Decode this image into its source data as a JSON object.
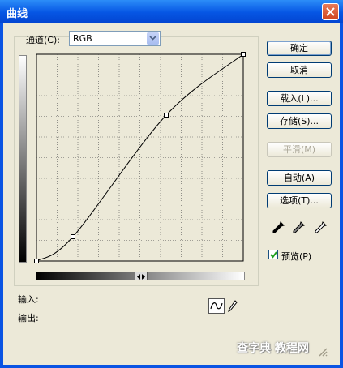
{
  "window": {
    "title": "曲线"
  },
  "channel": {
    "label": "通道(C):",
    "value": "RGB"
  },
  "io": {
    "input_label": "输入:",
    "output_label": "输出:"
  },
  "buttons": {
    "ok": "确定",
    "cancel": "取消",
    "load": "载入(L)...",
    "save": "存储(S)...",
    "smooth": "平滑(M)",
    "auto": "自动(A)",
    "options": "选项(T)..."
  },
  "preview": {
    "label": "预览(P)",
    "checked": true
  },
  "watermark": {
    "text": "查字典 教程网"
  },
  "curve": {
    "points": [
      [
        0,
        0
      ],
      [
        45,
        30
      ],
      [
        160,
        180
      ],
      [
        255,
        255
      ]
    ]
  },
  "icons": [
    "close-icon",
    "dropdown-arrow-icon",
    "black-eyedropper-icon",
    "gray-eyedropper-icon",
    "white-eyedropper-icon",
    "curve-mode-icon",
    "pencil-icon",
    "checkmark-icon",
    "resize-grip-icon"
  ]
}
